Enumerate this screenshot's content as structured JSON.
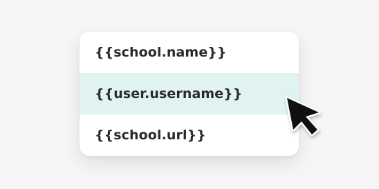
{
  "menu": {
    "items": [
      {
        "label": "{{school.name}}"
      },
      {
        "label": "{{user.username}}"
      },
      {
        "label": "{{school.url}}"
      }
    ],
    "active_index": 1
  },
  "colors": {
    "background": "#f6f6f6",
    "menu_background": "#ffffff",
    "active_item_background": "#e0f3f1",
    "text": "#2a2a2a",
    "cursor_fill": "#111111",
    "cursor_outline": "#ffffff"
  },
  "icons": {
    "cursor": "mouse-pointer-icon"
  }
}
